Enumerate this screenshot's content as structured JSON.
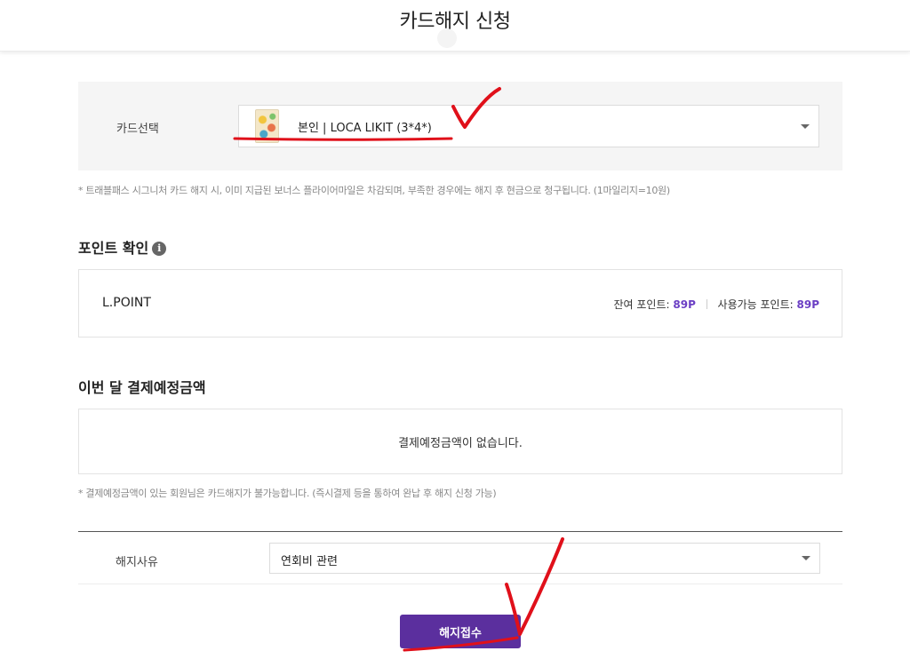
{
  "header": {
    "title": "카드해지 신청"
  },
  "card": {
    "label": "카드선택",
    "selected": "본인 | LOCA LIKIT (3*4*)"
  },
  "note1": "* 트래블패스 시그니처 카드 해지 시, 이미 지급된 보너스 플라이어마일은 차감되며, 부족한 경우에는 해지 후 현금으로 청구됩니다. (1마일리지=10원)",
  "points": {
    "title": "포인트 확인",
    "info_icon": "info-icon",
    "name": "L.POINT",
    "balance_label": "잔여 포인트:",
    "balance_value": "89P",
    "usable_label": "사용가능 포인트:",
    "usable_value": "89P"
  },
  "payment": {
    "title": "이번 달 결제예정금액",
    "message": "결제예정금액이 없습니다."
  },
  "note2": "* 결제예정금액이 있는 회원님은 카드해지가 불가능합니다. (즉시결제 등을 통하여 완납 후 해지 신청 가능)",
  "reason": {
    "label": "해지사유",
    "selected": "연회비 관련"
  },
  "submit_label": "해지접수",
  "colors": {
    "accent": "#5b2f9e",
    "point_value": "#6b3fc4",
    "annotation": "#e0101a"
  }
}
